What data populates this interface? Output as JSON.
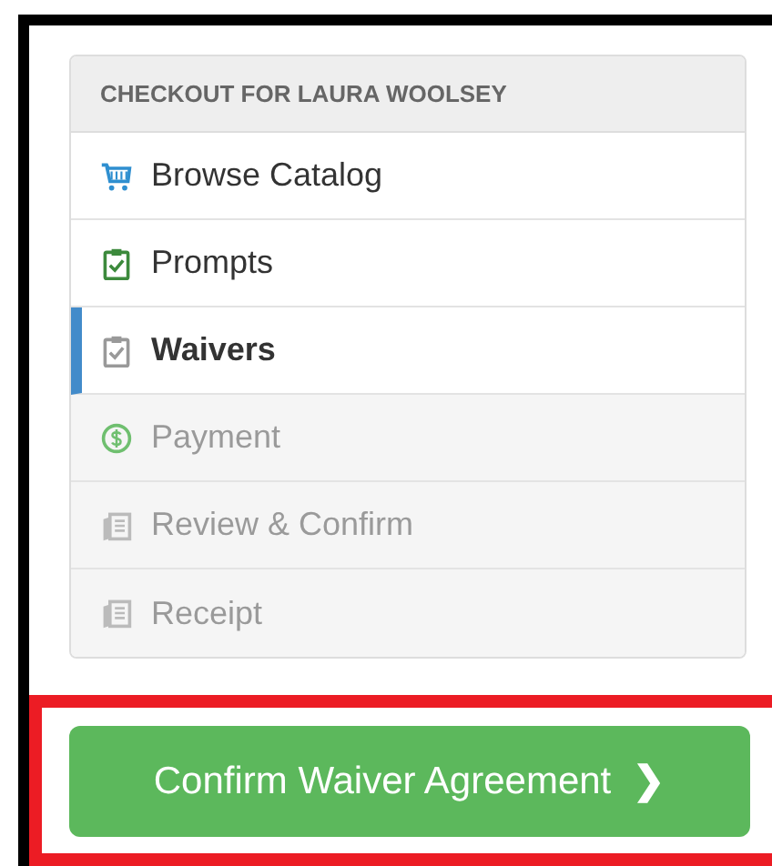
{
  "panel": {
    "title": "CHECKOUT FOR LAURA WOOLSEY",
    "steps": [
      {
        "label": "Browse Catalog",
        "kind": "cart",
        "selected": false,
        "disabled": false
      },
      {
        "label": "Prompts",
        "kind": "clipboard",
        "selected": false,
        "disabled": false
      },
      {
        "label": "Waivers",
        "kind": "clipboard",
        "selected": true,
        "disabled": false
      },
      {
        "label": "Payment",
        "kind": "payment",
        "selected": false,
        "disabled": true
      },
      {
        "label": "Review & Confirm",
        "kind": "document",
        "selected": false,
        "disabled": true
      },
      {
        "label": "Receipt",
        "kind": "document",
        "selected": false,
        "disabled": true
      }
    ]
  },
  "confirm_button": {
    "label": "Confirm Waiver Agreement",
    "icon_glyph": "❯"
  }
}
